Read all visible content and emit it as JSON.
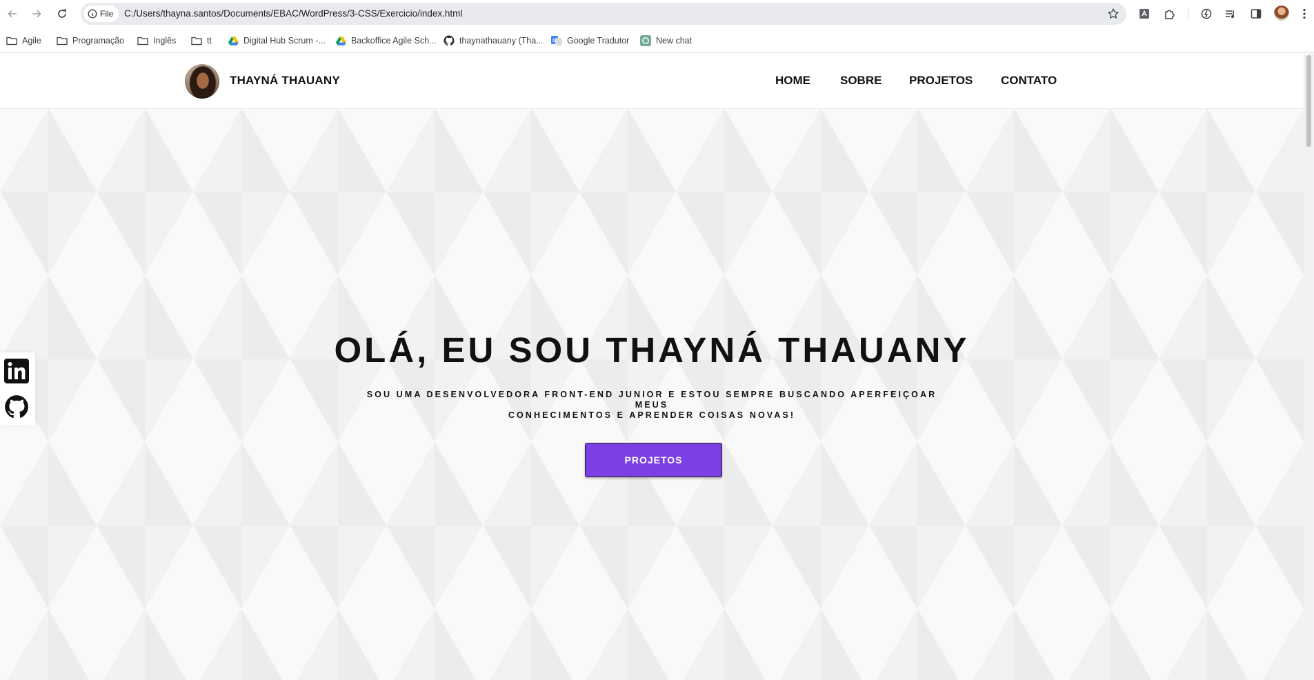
{
  "browser": {
    "site_chip": "File",
    "url": "C:/Users/thayna.santos/Documents/EBAC/WordPress/3-CSS/Exercicio/index.html",
    "bookmarks": [
      {
        "label": "Agile",
        "icon": "folder-icon"
      },
      {
        "label": "Programação",
        "icon": "folder-icon"
      },
      {
        "label": "Inglês",
        "icon": "folder-icon"
      },
      {
        "label": "tt",
        "icon": "folder-icon"
      },
      {
        "label": "Digital Hub Scrum -...",
        "icon": "drive-icon"
      },
      {
        "label": "Backoffice Agile Sch...",
        "icon": "drive-icon"
      },
      {
        "label": "thaynathauany (Tha...",
        "icon": "github-icon"
      },
      {
        "label": "Google Tradutor",
        "icon": "translate-icon"
      },
      {
        "label": "New chat",
        "icon": "chatgpt-icon"
      }
    ]
  },
  "site": {
    "brand": "THAYNÁ THAUANY",
    "nav": [
      "HOME",
      "SOBRE",
      "PROJETOS",
      "CONTATO"
    ],
    "hero": {
      "title": "OLÁ, EU SOU THAYNÁ THAUANY",
      "subtitle_line1": "SOU UMA DESENVOLVEDORA FRONT-END JUNIOR E ESTOU SEMPRE BUSCANDO APERFEIÇOAR MEUS",
      "subtitle_line2": "CONHECIMENTOS E APRENDER COISAS NOVAS!",
      "button": "PROJETOS"
    },
    "social": [
      "linkedin-icon",
      "github-icon"
    ],
    "accent_color": "#7b3fe4"
  }
}
